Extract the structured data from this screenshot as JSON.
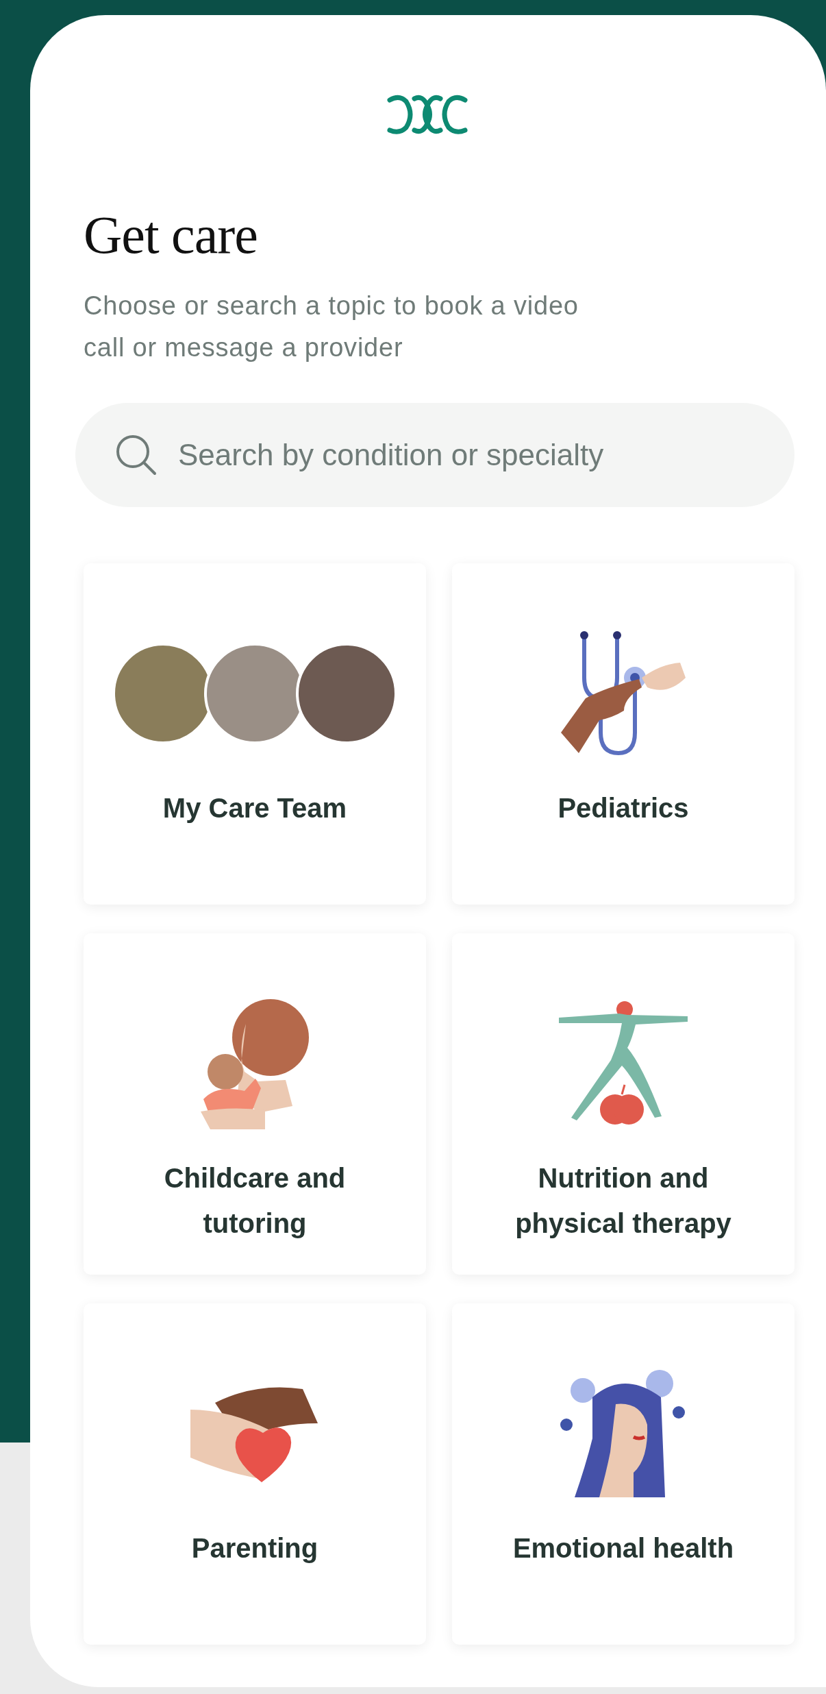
{
  "header": {
    "title": "Get care",
    "subtitle": "Choose or search a topic to book a video call or message a provider"
  },
  "search": {
    "placeholder": "Search by condition or specialty"
  },
  "topics": [
    {
      "kind": "team",
      "label": "My Care Team"
    },
    {
      "kind": "stethoscope",
      "label": "Pediatrics"
    },
    {
      "kind": "childcare",
      "label": "Childcare and tutoring"
    },
    {
      "kind": "yoga",
      "label": "Nutrition and physical therapy"
    },
    {
      "kind": "heart",
      "label": "Parenting"
    },
    {
      "kind": "meditation",
      "label": "Emotional health"
    }
  ]
}
